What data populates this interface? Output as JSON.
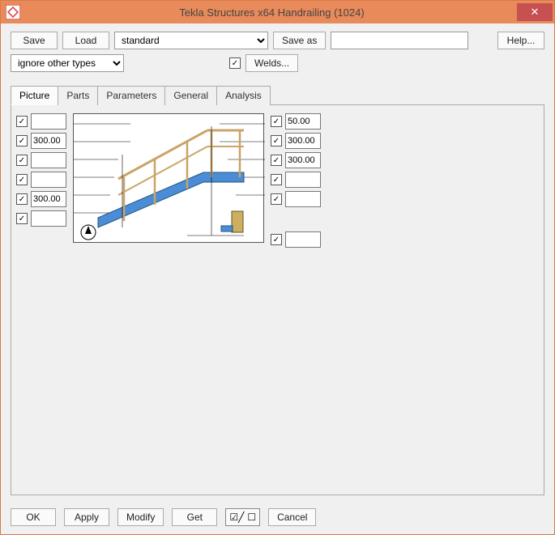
{
  "title": "Tekla Structures x64  Handrailing (1024)",
  "toolbar": {
    "save": "Save",
    "load": "Load",
    "preset": "standard",
    "save_as": "Save as",
    "saveas_value": "",
    "help": "Help...",
    "ignore_options": "ignore other types",
    "welds": "Welds..."
  },
  "tabs": [
    "Picture",
    "Parts",
    "Parameters",
    "General",
    "Analysis"
  ],
  "active_tab": 0,
  "left_fields": [
    "",
    "300.00",
    "",
    "",
    "300.00",
    ""
  ],
  "right_fields": [
    "50.00",
    "300.00",
    "300.00",
    "",
    "",
    ""
  ],
  "footer": {
    "ok": "OK",
    "apply": "Apply",
    "modify": "Modify",
    "get": "Get",
    "cancel": "Cancel"
  }
}
